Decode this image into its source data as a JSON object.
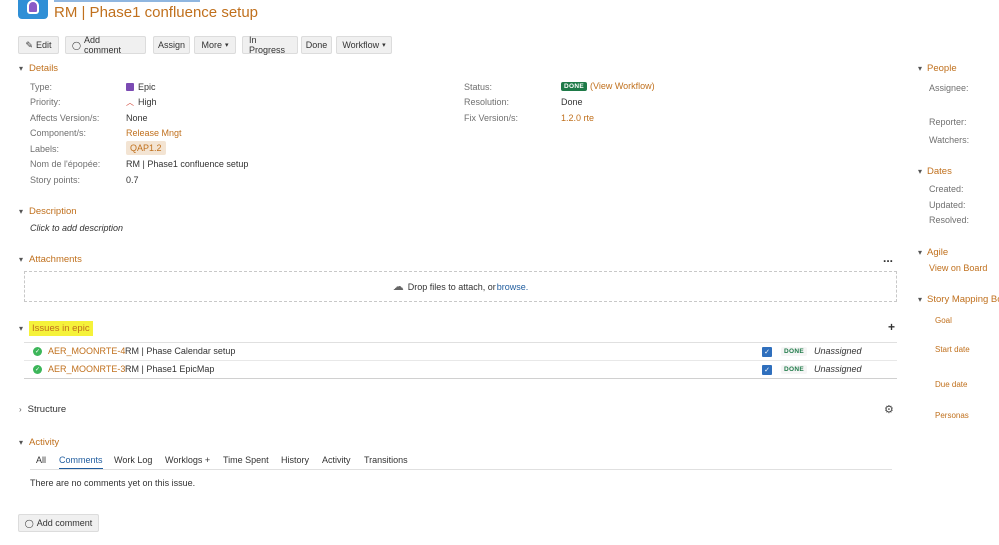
{
  "header": {
    "title": "RM | Phase1 confluence setup"
  },
  "toolbar": {
    "edit": "Edit",
    "add_comment": "Add comment",
    "assign": "Assign",
    "more": "More",
    "in_progress": "In Progress",
    "done": "Done",
    "workflow": "Workflow"
  },
  "details": {
    "heading": "Details",
    "type_label": "Type:",
    "type_value": "Epic",
    "priority_label": "Priority:",
    "priority_value": "High",
    "affects_label": "Affects Version/s:",
    "affects_value": "None",
    "component_label": "Component/s:",
    "component_value": "Release Mngt",
    "labels_label": "Labels:",
    "labels_value": "QAP1.2",
    "epic_name_label": "Nom de l'épopée:",
    "epic_name_value": "RM | Phase1 confluence setup",
    "story_points_label": "Story points:",
    "story_points_value": "0.7",
    "status_label": "Status:",
    "status_value": "DONE",
    "view_workflow": "(View Workflow)",
    "resolution_label": "Resolution:",
    "resolution_value": "Done",
    "fix_label": "Fix Version/s:",
    "fix_value": "1.2.0 rte"
  },
  "description": {
    "heading": "Description",
    "placeholder": "Click to add description"
  },
  "attachments": {
    "heading": "Attachments",
    "drop_text": "Drop files to attach, or ",
    "browse": "browse.",
    "more": "..."
  },
  "issues": {
    "heading": "Issues in epic",
    "rows": [
      {
        "key": "AER_MOONRTE-4",
        "summary": "RM | Phase Calendar setup",
        "status": "DONE",
        "assignee": "Unassigned"
      },
      {
        "key": "AER_MOONRTE-3",
        "summary": "RM | Phase1 EpicMap",
        "status": "DONE",
        "assignee": "Unassigned"
      }
    ]
  },
  "structure": {
    "heading": "Structure"
  },
  "activity": {
    "heading": "Activity",
    "tabs": [
      "All",
      "Comments",
      "Work Log",
      "Worklogs +",
      "Time Spent",
      "History",
      "Activity",
      "Transitions"
    ],
    "empty": "There are no comments yet on this issue.",
    "add_comment": "Add comment"
  },
  "sidebar": {
    "people": "People",
    "assignee": "Assignee:",
    "reporter": "Reporter:",
    "watchers": "Watchers:",
    "dates": "Dates",
    "created": "Created:",
    "updated": "Updated:",
    "resolved": "Resolved:",
    "agile": "Agile",
    "view_on_board": "View on Board",
    "story_mapping": "Story Mapping Bo",
    "goal": "Goal",
    "start_date": "Start date",
    "due_date": "Due date",
    "personas": "Personas"
  },
  "colors": {
    "accent": "#c0701d",
    "link": "#1f5c9e",
    "done_green": "#1e7a48",
    "highlight": "#f5f23a"
  }
}
